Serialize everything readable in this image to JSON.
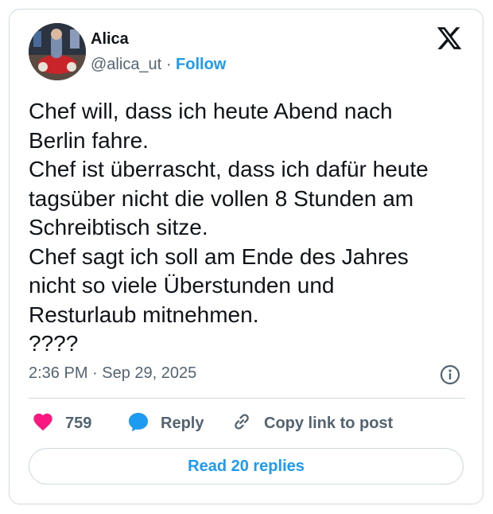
{
  "author": {
    "name": "Alica",
    "handle": "@alica_ut",
    "separator": "·",
    "follow_label": "Follow"
  },
  "tweet": {
    "lines": [
      "Chef will, dass ich heute Abend nach",
      "Berlin fahre.",
      "Chef ist überrascht, dass ich dafür heute",
      "tagsüber nicht die vollen 8 Stunden am",
      "Schreibtisch sitze.",
      "Chef sagt ich soll am Ende des Jahres",
      "nicht so viele Überstunden und",
      "Resturlaub mitnehmen.",
      "????"
    ],
    "timestamp": "2:36 PM · Sep 29, 2025"
  },
  "actions": {
    "like_count": "759",
    "reply_label": "Reply",
    "copy_label": "Copy link to post"
  },
  "read_replies_label": "Read 20 replies",
  "icons": {
    "brand": "x-logo-icon",
    "info": "info-icon",
    "like": "heart-icon",
    "reply": "reply-bubble-icon",
    "copy": "link-icon"
  },
  "colors": {
    "accent": "#1d9bf0",
    "like": "#f91880",
    "text": "#0f1419",
    "muted": "#536471",
    "border": "#cfd9de"
  }
}
